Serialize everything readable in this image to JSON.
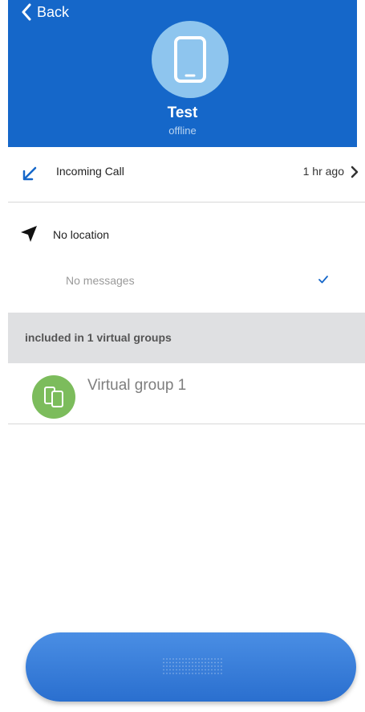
{
  "header": {
    "back_label": "Back",
    "device_name": "Test",
    "device_status": "offline",
    "avatar_icon": "smartphone-icon",
    "accent": "#1567c9"
  },
  "last_call": {
    "icon": "incoming-call-arrow-icon",
    "label": "Incoming Call",
    "time": "1 hr ago"
  },
  "location": {
    "icon": "location-arrow-icon",
    "label": "No location"
  },
  "messages": {
    "label": "No messages",
    "icon": "checkmark-icon"
  },
  "groups": {
    "header": "included in 1 virtual groups",
    "items": [
      {
        "name": "Virtual group 1",
        "icon": "two-phones-icon",
        "color": "#7cbc5c"
      }
    ]
  },
  "bottom_button": {
    "icon": "grip-dots-icon"
  }
}
